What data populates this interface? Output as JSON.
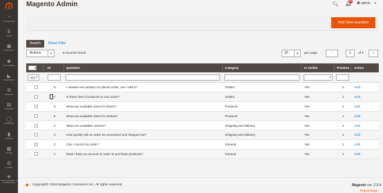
{
  "app": {
    "title": "Magento Admin"
  },
  "header": {
    "user_name": "admin",
    "notifications_count": "99"
  },
  "sidebar": {
    "items": [
      {
        "icon": "dashboard-icon",
        "label": "DASHBOARD",
        "glyph": "◔"
      },
      {
        "icon": "dollar-icon",
        "label": "SALES",
        "glyph": "$"
      },
      {
        "icon": "cube-icon",
        "label": "PRODUCTS",
        "glyph": "▣"
      },
      {
        "icon": "customers-icon",
        "label": "CUSTOMERS",
        "glyph": "☻"
      },
      {
        "icon": "megaphone-icon",
        "label": "MARKETING",
        "glyph": "◣"
      },
      {
        "icon": "supplies-icon",
        "label": "SUPPLIES",
        "glyph": "⚙"
      },
      {
        "icon": "content-icon",
        "label": "CONTENT",
        "glyph": "▤"
      },
      {
        "icon": "community-icon",
        "label": "COMMUNITY",
        "glyph": "◯"
      },
      {
        "icon": "reports-icon",
        "label": "REPORTS",
        "glyph": "▮"
      },
      {
        "icon": "stores-icon",
        "label": "STORES",
        "glyph": "▦"
      },
      {
        "icon": "system-icon",
        "label": "SYSTEM",
        "glyph": "⚙"
      },
      {
        "icon": "extensions-icon",
        "label": "FIND PARTNERS & EXTENSIONS",
        "glyph": "◈"
      }
    ]
  },
  "action_bar": {
    "add_label": "Add New question"
  },
  "toolbar": {
    "search_label": "Search",
    "reset_label": "Reset Filter",
    "actions_label": "Actions",
    "records_found": "8 records found",
    "per_page_value": "20",
    "per_page_label": "per page",
    "current_page": "1",
    "of_pages": "of 1"
  },
  "grid": {
    "columns": [
      "Id",
      "Question",
      "Category",
      "Is visible",
      "Position",
      "Action"
    ],
    "filter_any": "Any",
    "rows": [
      {
        "id": "8",
        "question": "I missed one product on placed order, can I edit it?",
        "category": "Orders",
        "visible": "Yes",
        "position": "2",
        "action": "Edit"
      },
      {
        "id": "7",
        "question": "Is there limit of products in one order?",
        "category": "Orders",
        "visible": "Yes",
        "position": "1",
        "action": "Edit"
      },
      {
        "id": "6",
        "question": "What are available sizes for shoes?",
        "category": "Products",
        "visible": "Yes",
        "position": "2",
        "action": "Edit"
      },
      {
        "id": "5",
        "question": "What are available sizes for clothes?",
        "category": "Products",
        "visible": "Yes",
        "position": "1",
        "action": "Edit"
      },
      {
        "id": "4",
        "question": "What are available carriers?",
        "category": "Shipping and delivery",
        "visible": "Yes",
        "position": "2",
        "action": "Edit"
      },
      {
        "id": "3",
        "question": "How quickly will an order be processed and shipped out?",
        "category": "Shipping and delivery",
        "visible": "Yes",
        "position": "1",
        "action": "Edit"
      },
      {
        "id": "2",
        "question": "Can I cancel my order?",
        "category": "General",
        "visible": "Yes",
        "position": "2",
        "action": "Edit"
      },
      {
        "id": "1",
        "question": "Must I have an account in order to purchase products?",
        "category": "General",
        "visible": "Yes",
        "position": "1",
        "action": "Edit"
      }
    ]
  },
  "footer": {
    "copyright": "Copyright© 2016 Magento Commerce Inc. All rights reserved.",
    "version_label": "Magento",
    "version": "ver. 2.0.4",
    "report_bugs": "Report Bugs"
  },
  "colors": {
    "accent": "#eb5202",
    "sidebar": "#373330",
    "grid_header": "#514943",
    "link": "#007bdb"
  }
}
